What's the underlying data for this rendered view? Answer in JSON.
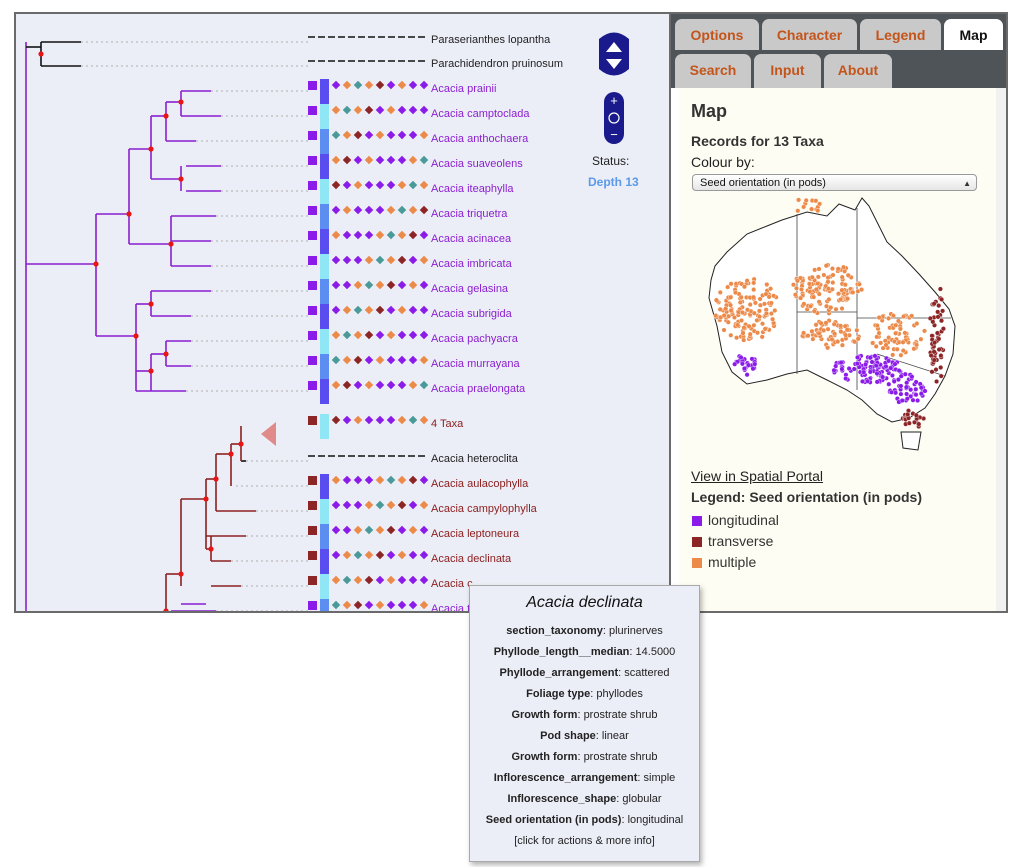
{
  "tabs": [
    {
      "label": "Options",
      "active": false
    },
    {
      "label": "Character",
      "active": false
    },
    {
      "label": "Legend",
      "active": false
    },
    {
      "label": "Map",
      "active": true
    },
    {
      "label": "Search",
      "active": false
    },
    {
      "label": "Input",
      "active": false
    },
    {
      "label": "About",
      "active": false
    }
  ],
  "status": {
    "label": "Status:",
    "value": "Depth 13"
  },
  "map_panel": {
    "title": "Map",
    "records": "Records for 13 Taxa",
    "colour_by_label": "Colour by:",
    "colour_by_value": "Seed orientation (in pods)",
    "spatial_link": "View in Spatial Portal",
    "legend_title": "Legend: Seed orientation (in pods)",
    "legend": [
      {
        "label": "longitudinal",
        "color": "#8a1be8"
      },
      {
        "label": "transverse",
        "color": "#8c2525"
      },
      {
        "label": "multiple",
        "color": "#ec8a4a"
      }
    ]
  },
  "taxa": [
    {
      "name": "Paraserianthes lopantha",
      "color": "black"
    },
    {
      "name": "Parachidendron pruinosum",
      "color": "black"
    },
    {
      "name": "Acacia prainii",
      "color": "purple"
    },
    {
      "name": "Acacia camptoclada",
      "color": "purple"
    },
    {
      "name": "Acacia anthochaera",
      "color": "purple"
    },
    {
      "name": "Acacia suaveolens",
      "color": "purple"
    },
    {
      "name": "Acacia iteaphylla",
      "color": "purple"
    },
    {
      "name": "Acacia triquetra",
      "color": "purple"
    },
    {
      "name": "Acacia acinacea",
      "color": "purple"
    },
    {
      "name": "Acacia imbricata",
      "color": "purple"
    },
    {
      "name": "Acacia gelasina",
      "color": "purple"
    },
    {
      "name": "Acacia subrigida",
      "color": "purple"
    },
    {
      "name": "Acacia pachyacra",
      "color": "purple"
    },
    {
      "name": "Acacia murrayana",
      "color": "purple"
    },
    {
      "name": "Acacia praelongata",
      "color": "purple"
    },
    {
      "name": "4 Taxa",
      "color": "red"
    },
    {
      "name": "Acacia heteroclita",
      "color": "black"
    },
    {
      "name": "Acacia aulacophylla",
      "color": "red"
    },
    {
      "name": "Acacia campylophylla",
      "color": "red"
    },
    {
      "name": "Acacia leptoneura",
      "color": "red"
    },
    {
      "name": "Acacia declinata",
      "color": "red"
    },
    {
      "name": "Acacia c",
      "color": "red"
    },
    {
      "name": "Acacia t",
      "color": "purple"
    }
  ],
  "tooltip": {
    "title": "Acacia declinata",
    "rows": [
      {
        "key": "section_taxonomy",
        "value": "plurinerves"
      },
      {
        "key": "Phyllode_length__median",
        "value": "14.5000"
      },
      {
        "key": "Phyllode_arrangement",
        "value": "scattered"
      },
      {
        "key": "Foliage type",
        "value": "phyllodes"
      },
      {
        "key": "Growth form",
        "value": "prostrate shrub"
      },
      {
        "key": "Pod shape",
        "value": "linear"
      },
      {
        "key": "Growth form",
        "value": "prostrate shrub"
      },
      {
        "key": "Inflorescence_arrangement",
        "value": "simple"
      },
      {
        "key": "Inflorescence_shape",
        "value": "globular"
      },
      {
        "key": "Seed orientation (in pods)",
        "value": "longitudinal"
      }
    ],
    "footer": "[click for actions & more info]"
  },
  "colors": {
    "purple_branch": "#8a1fd0",
    "red_branch": "#8c2020",
    "node": "#e81515",
    "nav": "#1a1a8c"
  }
}
